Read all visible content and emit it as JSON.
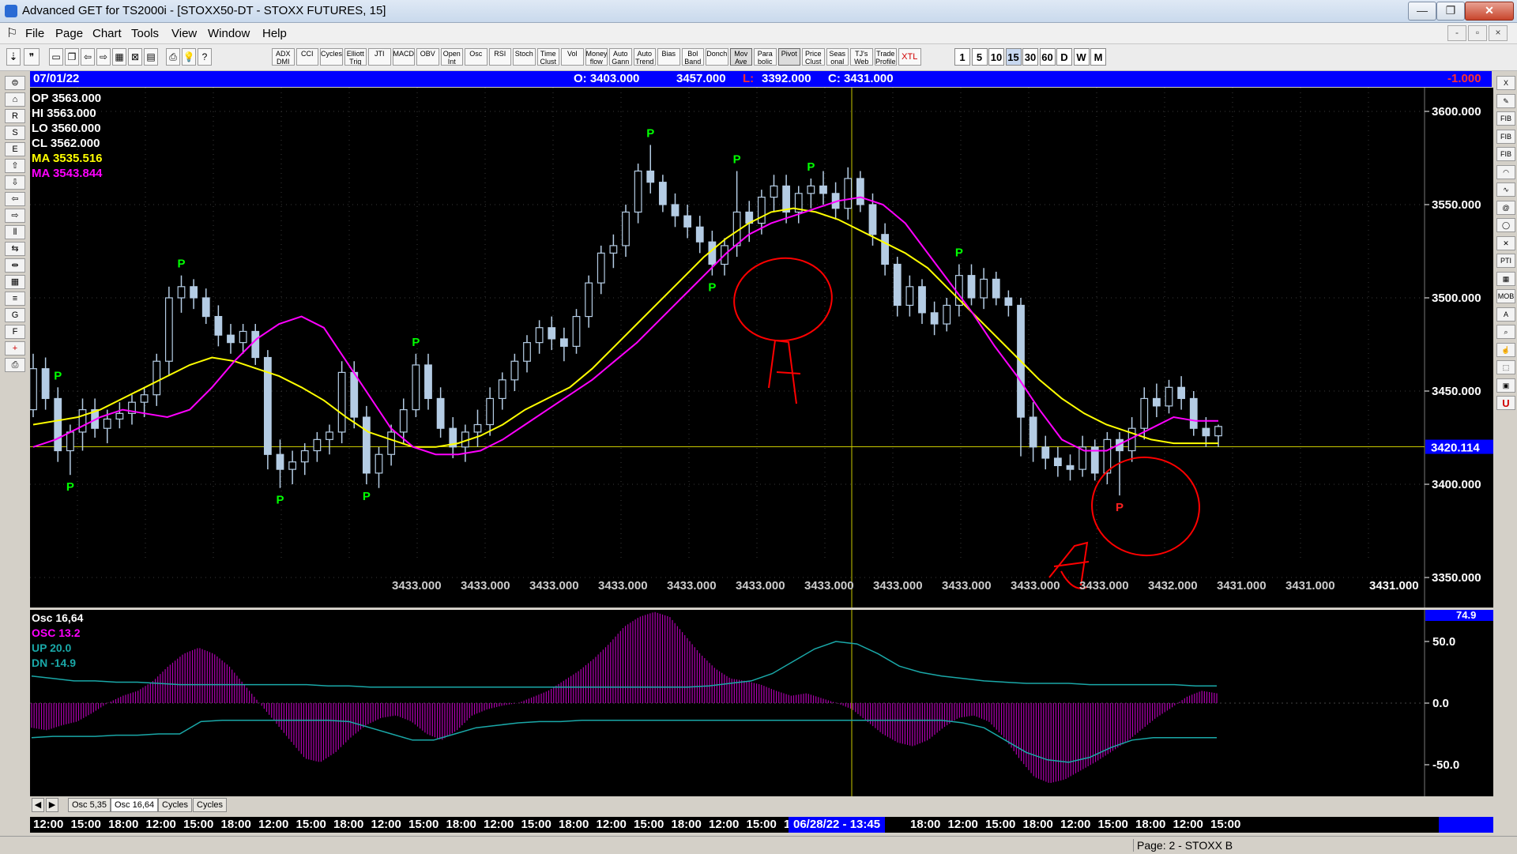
{
  "window": {
    "title": "Advanced GET for TS2000i - [STOXX50-DT - STOXX FUTURES, 15]",
    "buttons": {
      "minimize": "—",
      "restore": "❐",
      "close": "✕"
    }
  },
  "menu": {
    "items": [
      "File",
      "Page",
      "Chart",
      "Tools",
      "View",
      "Window",
      "Help"
    ],
    "mdi_buttons": [
      "-",
      "▫",
      "×"
    ]
  },
  "toolbar": {
    "studies": [
      "ADX DMI",
      "CCI",
      "Cycles",
      "Elliott Trig",
      "JTI",
      "MACD",
      "OBV",
      "Open Int",
      "Osc",
      "RSI",
      "Stoch",
      "Time Clust",
      "Vol",
      "Money flow",
      "Auto Gann",
      "Auto Trend",
      "Bias",
      "Bol Band",
      "Donch",
      "Mov Ave",
      "Para bolic",
      "Pivot",
      "Price Clust",
      "Seas onal",
      "TJ's Web",
      "Trade Profile",
      "XTL"
    ],
    "timeframes": [
      "1",
      "5",
      "10",
      "15",
      "30",
      "60",
      "D",
      "W",
      "M"
    ],
    "active_timeframe": "15"
  },
  "left_tools": [
    "open",
    "gann",
    "reset",
    "study",
    "elliott",
    "up",
    "down",
    "left",
    "right",
    "bars",
    "fan",
    "zoom",
    "grid",
    "lines",
    "gann",
    "fib",
    "plus",
    "print"
  ],
  "right_tools": [
    "X",
    "pen",
    "FIB RET",
    "FIB EXT",
    "FIB TIME",
    "arc",
    "wave",
    "spiral",
    "ellipse",
    "gann",
    "PTI",
    "grid",
    "MOB",
    "A",
    "zoom",
    "hand",
    "select",
    "copy",
    "U"
  ],
  "info_bar": {
    "date": "07/01/22",
    "open": "O: 3403.000",
    "high": "3457.000",
    "low_label": "L:",
    "low_value": "3392.000",
    "close": "C: 3431.000",
    "change": "-1.000"
  },
  "readout": {
    "op": "OP  3563.000",
    "hi": "HI   3563.000",
    "lo": "LO   3560.000",
    "cl": "CL   3562.000",
    "ma1": "MA  3535.516",
    "ma2": "MA  3543.844"
  },
  "price_axis": [
    "3600.000",
    "3550.000",
    "3500.000",
    "3450.000",
    "3400.000",
    "3350.000"
  ],
  "current_price": "3420.114",
  "bottom_values": [
    "3433.000",
    "3433.000",
    "3433.000",
    "3433.000",
    "3433.000",
    "3433.000",
    "3433.000",
    "3433.000",
    "3433.000",
    "3433.000",
    "3433.000",
    "3432.000",
    "3431.000",
    "3431.000"
  ],
  "last_value": "3431.000",
  "pivot_marker": "P",
  "osc": {
    "title": "Osc 16,64",
    "osc": "OSC 13.2",
    "up": "UP   20.0",
    "dn": "DN   -14.9",
    "axis": [
      "74.9",
      "50.0",
      "0.0",
      "-50.0"
    ]
  },
  "tabs": [
    "Osc 5,35",
    "Osc 16,64",
    "Cycles",
    "Cycles"
  ],
  "active_tab": "Osc 16,64",
  "time_axis": [
    "12:00",
    "15:00",
    "18:00",
    "12:00",
    "15:00",
    "18:00",
    "12:00",
    "15:00",
    "18:00",
    "12:00",
    "15:00",
    "18:00",
    "12:00",
    "15:00",
    "18:00",
    "12:00",
    "15:00",
    "18:00",
    "12:00",
    "15:00",
    "1",
    "06/28/22 - 13:45",
    "18:00",
    "12:00",
    "15:00",
    "18:00",
    "12:00",
    "15:00",
    "18:00",
    "12:00",
    "15:00"
  ],
  "status": "Page: 2 - STOXX B",
  "colors": {
    "bg": "#000000",
    "candles": "#b4cce4",
    "ma_fast": "#ffff00",
    "ma_slow": "#ff00ff",
    "pivot_high": "#00ff00",
    "pivot_low": "#00ff00",
    "pivot_red": "#ff2020",
    "annotation": "#ff0000",
    "osc_hist": "#b000b0",
    "band_line": "#1aa8a8"
  },
  "chart_data": {
    "type": "candlestick",
    "price_levels": [
      3600,
      3550,
      3500,
      3450,
      3400,
      3350
    ],
    "current_price": 3420.114,
    "bars": [
      [
        3440,
        3470,
        3436,
        3462
      ],
      [
        3462,
        3468,
        3440,
        3446
      ],
      [
        3446,
        3452,
        3412,
        3418
      ],
      [
        3418,
        3432,
        3405,
        3428
      ],
      [
        3428,
        3446,
        3418,
        3440
      ],
      [
        3440,
        3446,
        3425,
        3430
      ],
      [
        3430,
        3440,
        3422,
        3435
      ],
      [
        3435,
        3444,
        3430,
        3438
      ],
      [
        3438,
        3448,
        3432,
        3444
      ],
      [
        3444,
        3452,
        3436,
        3448
      ],
      [
        3448,
        3470,
        3442,
        3466
      ],
      [
        3466,
        3506,
        3458,
        3500
      ],
      [
        3500,
        3512,
        3492,
        3506
      ],
      [
        3506,
        3510,
        3494,
        3500
      ],
      [
        3500,
        3505,
        3486,
        3490
      ],
      [
        3490,
        3496,
        3474,
        3480
      ],
      [
        3480,
        3486,
        3470,
        3476
      ],
      [
        3476,
        3486,
        3470,
        3482
      ],
      [
        3482,
        3486,
        3464,
        3468
      ],
      [
        3468,
        3472,
        3408,
        3416
      ],
      [
        3416,
        3424,
        3398,
        3408
      ],
      [
        3408,
        3418,
        3400,
        3412
      ],
      [
        3412,
        3422,
        3405,
        3418
      ],
      [
        3418,
        3428,
        3412,
        3424
      ],
      [
        3424,
        3432,
        3416,
        3428
      ],
      [
        3428,
        3466,
        3422,
        3460
      ],
      [
        3460,
        3466,
        3430,
        3436
      ],
      [
        3436,
        3442,
        3400,
        3406
      ],
      [
        3406,
        3420,
        3398,
        3416
      ],
      [
        3416,
        3432,
        3410,
        3428
      ],
      [
        3428,
        3446,
        3422,
        3440
      ],
      [
        3440,
        3470,
        3436,
        3464
      ],
      [
        3464,
        3470,
        3440,
        3446
      ],
      [
        3446,
        3452,
        3425,
        3430
      ],
      [
        3430,
        3436,
        3414,
        3420
      ],
      [
        3420,
        3432,
        3412,
        3428
      ],
      [
        3428,
        3440,
        3420,
        3432
      ],
      [
        3432,
        3452,
        3426,
        3446
      ],
      [
        3446,
        3460,
        3440,
        3456
      ],
      [
        3456,
        3470,
        3450,
        3466
      ],
      [
        3466,
        3480,
        3460,
        3476
      ],
      [
        3476,
        3488,
        3470,
        3484
      ],
      [
        3484,
        3490,
        3472,
        3478
      ],
      [
        3478,
        3484,
        3466,
        3474
      ],
      [
        3474,
        3494,
        3470,
        3490
      ],
      [
        3490,
        3512,
        3484,
        3508
      ],
      [
        3508,
        3528,
        3502,
        3524
      ],
      [
        3524,
        3534,
        3516,
        3528
      ],
      [
        3528,
        3550,
        3522,
        3546
      ],
      [
        3546,
        3572,
        3540,
        3568
      ],
      [
        3568,
        3582,
        3556,
        3562
      ],
      [
        3562,
        3566,
        3546,
        3550
      ],
      [
        3550,
        3556,
        3538,
        3544
      ],
      [
        3544,
        3550,
        3532,
        3538
      ],
      [
        3538,
        3544,
        3524,
        3530
      ],
      [
        3530,
        3536,
        3512,
        3518
      ],
      [
        3518,
        3532,
        3512,
        3528
      ],
      [
        3528,
        3568,
        3522,
        3546
      ],
      [
        3546,
        3552,
        3530,
        3540
      ],
      [
        3540,
        3558,
        3534,
        3554
      ],
      [
        3554,
        3566,
        3546,
        3560
      ],
      [
        3560,
        3566,
        3540,
        3546
      ],
      [
        3546,
        3560,
        3540,
        3556
      ],
      [
        3556,
        3564,
        3548,
        3560
      ],
      [
        3560,
        3568,
        3550,
        3556
      ],
      [
        3556,
        3562,
        3542,
        3548
      ],
      [
        3548,
        3570,
        3542,
        3564
      ],
      [
        3564,
        3568,
        3546,
        3550
      ],
      [
        3550,
        3556,
        3528,
        3534
      ],
      [
        3534,
        3540,
        3512,
        3518
      ],
      [
        3518,
        3522,
        3490,
        3496
      ],
      [
        3496,
        3512,
        3490,
        3506
      ],
      [
        3506,
        3510,
        3486,
        3492
      ],
      [
        3492,
        3498,
        3480,
        3486
      ],
      [
        3486,
        3500,
        3482,
        3496
      ],
      [
        3496,
        3518,
        3490,
        3512
      ],
      [
        3512,
        3518,
        3496,
        3500
      ],
      [
        3500,
        3516,
        3494,
        3510
      ],
      [
        3510,
        3514,
        3496,
        3500
      ],
      [
        3500,
        3504,
        3490,
        3496
      ],
      [
        3496,
        3500,
        3415,
        3436
      ],
      [
        3436,
        3444,
        3412,
        3420
      ],
      [
        3420,
        3426,
        3408,
        3414
      ],
      [
        3414,
        3420,
        3404,
        3410
      ],
      [
        3410,
        3416,
        3402,
        3408
      ],
      [
        3408,
        3426,
        3404,
        3420
      ],
      [
        3420,
        3424,
        3402,
        3406
      ],
      [
        3406,
        3428,
        3400,
        3424
      ],
      [
        3424,
        3428,
        3394,
        3418
      ],
      [
        3418,
        3436,
        3412,
        3430
      ],
      [
        3430,
        3452,
        3424,
        3446
      ],
      [
        3446,
        3454,
        3436,
        3442
      ],
      [
        3442,
        3456,
        3438,
        3452
      ],
      [
        3452,
        3458,
        3440,
        3446
      ],
      [
        3446,
        3450,
        3426,
        3430
      ],
      [
        3430,
        3436,
        3420,
        3426
      ],
      [
        3426,
        3432,
        3420,
        3431
      ]
    ],
    "ma_fast": [
      3432,
      3434,
      3436,
      3440,
      3446,
      3452,
      3458,
      3464,
      3468,
      3466,
      3462,
      3458,
      3452,
      3445,
      3436,
      3428,
      3424,
      3420,
      3420,
      3422,
      3426,
      3432,
      3440,
      3446,
      3452,
      3462,
      3474,
      3486,
      3498,
      3510,
      3522,
      3532,
      3540,
      3546,
      3548,
      3546,
      3542,
      3536,
      3530,
      3524,
      3516,
      3504,
      3492,
      3480,
      3468,
      3456,
      3446,
      3438,
      3432,
      3428,
      3424,
      3422,
      3422,
      3422
    ],
    "ma_slow": [
      3420,
      3424,
      3430,
      3436,
      3440,
      3438,
      3436,
      3440,
      3452,
      3466,
      3478,
      3486,
      3490,
      3484,
      3466,
      3448,
      3430,
      3420,
      3416,
      3416,
      3418,
      3424,
      3432,
      3440,
      3448,
      3456,
      3466,
      3476,
      3488,
      3500,
      3512,
      3524,
      3534,
      3540,
      3544,
      3548,
      3552,
      3554,
      3550,
      3540,
      3524,
      3508,
      3492,
      3474,
      3458,
      3440,
      3424,
      3418,
      3418,
      3424,
      3430,
      3436,
      3434,
      3434
    ],
    "pivots": [
      {
        "label": "P",
        "bar": 2,
        "type": "high"
      },
      {
        "label": "P",
        "bar": 3,
        "type": "low"
      },
      {
        "label": "P",
        "bar": 12,
        "type": "high"
      },
      {
        "label": "P",
        "bar": 20,
        "type": "low"
      },
      {
        "label": "P",
        "bar": 27,
        "type": "low"
      },
      {
        "label": "P",
        "bar": 31,
        "type": "high"
      },
      {
        "label": "P",
        "bar": 50,
        "type": "high"
      },
      {
        "label": "P",
        "bar": 55,
        "type": "low"
      },
      {
        "label": "P",
        "bar": 57,
        "type": "high"
      },
      {
        "label": "P",
        "bar": 63,
        "type": "high"
      },
      {
        "label": "P",
        "bar": 75,
        "type": "high"
      },
      {
        "label": "P",
        "bar": 88,
        "type": "low"
      }
    ],
    "oscillator": {
      "hist": [
        -20,
        -22,
        -18,
        -15,
        -8,
        0,
        6,
        10,
        18,
        30,
        40,
        45,
        40,
        30,
        15,
        0,
        -15,
        -30,
        -45,
        -48,
        -40,
        -28,
        -18,
        -12,
        -10,
        -15,
        -25,
        -30,
        -22,
        -10,
        -5,
        -2,
        0,
        5,
        10,
        18,
        26,
        36,
        48,
        62,
        70,
        74,
        70,
        55,
        40,
        28,
        20,
        18,
        15,
        10,
        6,
        8,
        4,
        0,
        -5,
        -15,
        -25,
        -32,
        -35,
        -30,
        -20,
        -12,
        -10,
        -15,
        -28,
        -45,
        -60,
        -65,
        -62,
        -55,
        -48,
        -40,
        -32,
        -22,
        -12,
        -4,
        5,
        10,
        8
      ],
      "up": [
        22,
        20,
        18,
        18,
        17,
        17,
        16,
        15,
        15,
        15,
        15,
        15,
        15,
        15,
        14,
        14,
        13,
        13,
        13,
        13,
        13,
        13,
        13,
        13,
        13,
        13,
        13,
        13,
        13,
        13,
        13,
        13,
        14,
        16,
        18,
        24,
        34,
        44,
        50,
        48,
        40,
        30,
        25,
        22,
        20,
        18,
        17,
        16,
        16,
        16,
        15,
        15,
        15,
        15,
        15,
        14,
        14
      ],
      "dn": [
        -28,
        -27,
        -27,
        -27,
        -26,
        -26,
        -25,
        -25,
        -15,
        -14,
        -14,
        -14,
        -14,
        -14,
        -14,
        -15,
        -20,
        -25,
        -30,
        -30,
        -25,
        -20,
        -18,
        -16,
        -15,
        -15,
        -14,
        -14,
        -14,
        -14,
        -14,
        -14,
        -14,
        -14,
        -14,
        -14,
        -14,
        -14,
        -14,
        -14,
        -14,
        -14,
        -14,
        -14,
        -16,
        -20,
        -30,
        -40,
        -46,
        -48,
        -44,
        -36,
        -30,
        -28,
        -28,
        -28,
        -28
      ],
      "ylim": [
        -80,
        80
      ]
    }
  }
}
